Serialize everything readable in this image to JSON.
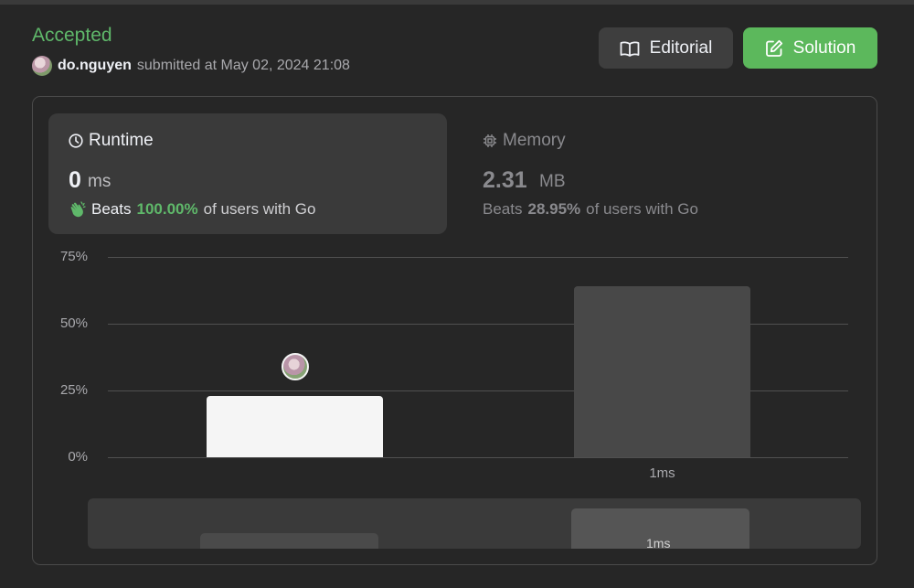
{
  "submission": {
    "status": "Accepted",
    "username": "do.nguyen",
    "submitted_text": "submitted at May 02, 2024 21:08"
  },
  "actions": {
    "editorial_label": "Editorial",
    "solution_label": "Solution"
  },
  "runtime": {
    "title": "Runtime",
    "value": "0",
    "unit": "ms",
    "beats_prefix": "Beats",
    "beats_percent": "100.00%",
    "beats_suffix": "of users with Go"
  },
  "memory": {
    "title": "Memory",
    "value": "2.31",
    "unit": "MB",
    "beats_prefix": "Beats",
    "beats_percent": "28.95%",
    "beats_suffix": "of users with Go"
  },
  "colors": {
    "accepted": "#5fb86a",
    "solution_button": "#5cb85c",
    "selected_bar": "#f5f5f5",
    "other_bar": "#484848"
  },
  "icons": {
    "editorial": "book-icon",
    "solution": "edit-icon",
    "runtime": "clock-icon",
    "memory": "chip-icon",
    "beats": "clap-icon"
  },
  "chart_data": {
    "type": "bar",
    "categories": [
      "",
      "1ms"
    ],
    "values": [
      23,
      64
    ],
    "ylim": [
      0,
      75
    ],
    "yticks": [
      "0%",
      "25%",
      "50%",
      "75%"
    ],
    "grid": true,
    "selected_index": 0
  },
  "overview": {
    "label": "1ms"
  }
}
